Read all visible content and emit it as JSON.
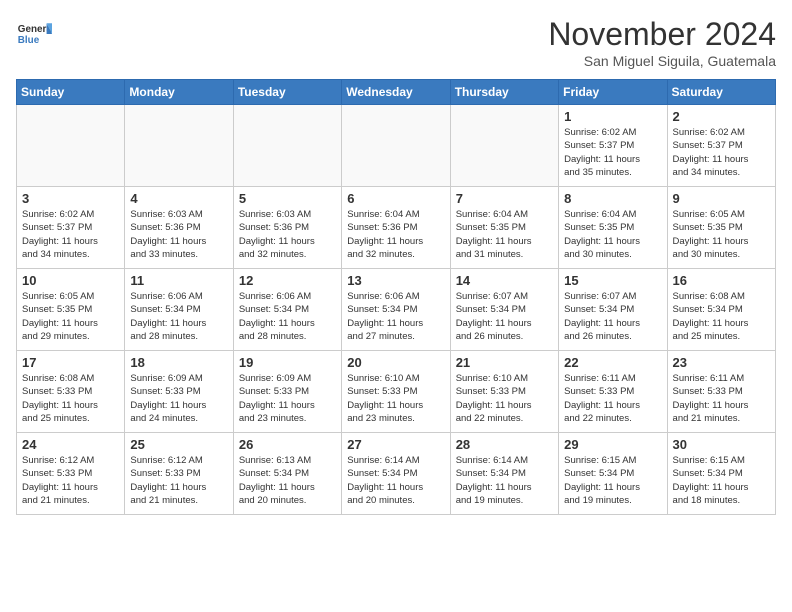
{
  "header": {
    "logo_line1": "General",
    "logo_line2": "Blue",
    "month": "November 2024",
    "location": "San Miguel Siguila, Guatemala"
  },
  "days_of_week": [
    "Sunday",
    "Monday",
    "Tuesday",
    "Wednesday",
    "Thursday",
    "Friday",
    "Saturday"
  ],
  "weeks": [
    [
      {
        "day": "",
        "info": ""
      },
      {
        "day": "",
        "info": ""
      },
      {
        "day": "",
        "info": ""
      },
      {
        "day": "",
        "info": ""
      },
      {
        "day": "",
        "info": ""
      },
      {
        "day": "1",
        "info": "Sunrise: 6:02 AM\nSunset: 5:37 PM\nDaylight: 11 hours\nand 35 minutes."
      },
      {
        "day": "2",
        "info": "Sunrise: 6:02 AM\nSunset: 5:37 PM\nDaylight: 11 hours\nand 34 minutes."
      }
    ],
    [
      {
        "day": "3",
        "info": "Sunrise: 6:02 AM\nSunset: 5:37 PM\nDaylight: 11 hours\nand 34 minutes."
      },
      {
        "day": "4",
        "info": "Sunrise: 6:03 AM\nSunset: 5:36 PM\nDaylight: 11 hours\nand 33 minutes."
      },
      {
        "day": "5",
        "info": "Sunrise: 6:03 AM\nSunset: 5:36 PM\nDaylight: 11 hours\nand 32 minutes."
      },
      {
        "day": "6",
        "info": "Sunrise: 6:04 AM\nSunset: 5:36 PM\nDaylight: 11 hours\nand 32 minutes."
      },
      {
        "day": "7",
        "info": "Sunrise: 6:04 AM\nSunset: 5:35 PM\nDaylight: 11 hours\nand 31 minutes."
      },
      {
        "day": "8",
        "info": "Sunrise: 6:04 AM\nSunset: 5:35 PM\nDaylight: 11 hours\nand 30 minutes."
      },
      {
        "day": "9",
        "info": "Sunrise: 6:05 AM\nSunset: 5:35 PM\nDaylight: 11 hours\nand 30 minutes."
      }
    ],
    [
      {
        "day": "10",
        "info": "Sunrise: 6:05 AM\nSunset: 5:35 PM\nDaylight: 11 hours\nand 29 minutes."
      },
      {
        "day": "11",
        "info": "Sunrise: 6:06 AM\nSunset: 5:34 PM\nDaylight: 11 hours\nand 28 minutes."
      },
      {
        "day": "12",
        "info": "Sunrise: 6:06 AM\nSunset: 5:34 PM\nDaylight: 11 hours\nand 28 minutes."
      },
      {
        "day": "13",
        "info": "Sunrise: 6:06 AM\nSunset: 5:34 PM\nDaylight: 11 hours\nand 27 minutes."
      },
      {
        "day": "14",
        "info": "Sunrise: 6:07 AM\nSunset: 5:34 PM\nDaylight: 11 hours\nand 26 minutes."
      },
      {
        "day": "15",
        "info": "Sunrise: 6:07 AM\nSunset: 5:34 PM\nDaylight: 11 hours\nand 26 minutes."
      },
      {
        "day": "16",
        "info": "Sunrise: 6:08 AM\nSunset: 5:34 PM\nDaylight: 11 hours\nand 25 minutes."
      }
    ],
    [
      {
        "day": "17",
        "info": "Sunrise: 6:08 AM\nSunset: 5:33 PM\nDaylight: 11 hours\nand 25 minutes."
      },
      {
        "day": "18",
        "info": "Sunrise: 6:09 AM\nSunset: 5:33 PM\nDaylight: 11 hours\nand 24 minutes."
      },
      {
        "day": "19",
        "info": "Sunrise: 6:09 AM\nSunset: 5:33 PM\nDaylight: 11 hours\nand 23 minutes."
      },
      {
        "day": "20",
        "info": "Sunrise: 6:10 AM\nSunset: 5:33 PM\nDaylight: 11 hours\nand 23 minutes."
      },
      {
        "day": "21",
        "info": "Sunrise: 6:10 AM\nSunset: 5:33 PM\nDaylight: 11 hours\nand 22 minutes."
      },
      {
        "day": "22",
        "info": "Sunrise: 6:11 AM\nSunset: 5:33 PM\nDaylight: 11 hours\nand 22 minutes."
      },
      {
        "day": "23",
        "info": "Sunrise: 6:11 AM\nSunset: 5:33 PM\nDaylight: 11 hours\nand 21 minutes."
      }
    ],
    [
      {
        "day": "24",
        "info": "Sunrise: 6:12 AM\nSunset: 5:33 PM\nDaylight: 11 hours\nand 21 minutes."
      },
      {
        "day": "25",
        "info": "Sunrise: 6:12 AM\nSunset: 5:33 PM\nDaylight: 11 hours\nand 21 minutes."
      },
      {
        "day": "26",
        "info": "Sunrise: 6:13 AM\nSunset: 5:34 PM\nDaylight: 11 hours\nand 20 minutes."
      },
      {
        "day": "27",
        "info": "Sunrise: 6:14 AM\nSunset: 5:34 PM\nDaylight: 11 hours\nand 20 minutes."
      },
      {
        "day": "28",
        "info": "Sunrise: 6:14 AM\nSunset: 5:34 PM\nDaylight: 11 hours\nand 19 minutes."
      },
      {
        "day": "29",
        "info": "Sunrise: 6:15 AM\nSunset: 5:34 PM\nDaylight: 11 hours\nand 19 minutes."
      },
      {
        "day": "30",
        "info": "Sunrise: 6:15 AM\nSunset: 5:34 PM\nDaylight: 11 hours\nand 18 minutes."
      }
    ]
  ]
}
